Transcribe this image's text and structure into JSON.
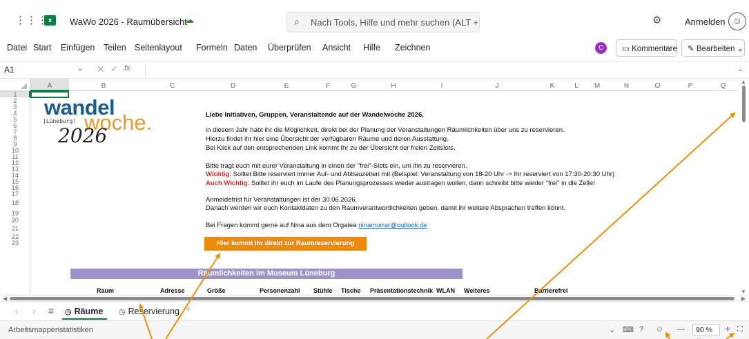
{
  "app": {
    "doc_title": "WaWo 2026 - Raumübersicht",
    "search_placeholder": "Nach Tools, Hilfe und mehr suchen (ALT + M",
    "signin_label": "Anmelden",
    "copilot_initial": "C"
  },
  "menu": {
    "items": [
      "Datei",
      "Start",
      "Einfügen",
      "Teilen",
      "Seitenlayout",
      "Formeln",
      "Daten",
      "Überprüfen",
      "Ansicht",
      "Hilfe",
      "Zeichnen"
    ],
    "comments_label": "Kommentare",
    "edit_label": "Bearbeiten"
  },
  "formula_bar": {
    "cell_ref": "A1",
    "fx": "fx",
    "value": ""
  },
  "grid": {
    "columns": [
      "A",
      "B",
      "C",
      "D",
      "E",
      "F",
      "G",
      "H",
      "I",
      "J",
      "K",
      "L",
      "M",
      "N",
      "O",
      "P",
      "Q"
    ],
    "rows": [
      "1",
      "2",
      "3",
      "4",
      "5",
      "6",
      "7",
      "8",
      "9",
      "10",
      "11",
      "12",
      "13",
      "14",
      "15",
      "16",
      "17",
      "18",
      "19",
      "20",
      "21",
      "22",
      "23"
    ],
    "selected_cell": "A1"
  },
  "logo": {
    "wandel": "wandel",
    "woche": "woche.",
    "lueneburg": "|Lüneburg!",
    "year": "2026"
  },
  "sheet": {
    "greeting": "Liebe Initiativen, Gruppen, Veranstaltende auf der Wandelwoche 2026,",
    "intro1": "in diesem Jahr habt ihr die Möglichkeit, direkt bei der Planung der Veranstaltungen Räumlichkeiten über uns zu reservieren.",
    "intro2": "Hierzu findet ihr hier eine Übersicht der verfügbaren Räume und deren Ausstattung.",
    "intro3": "Bei Klick auf den entsprechenden Link kommt Ihr zu der Übersicht der freien Zeitslots.",
    "instruction": "Bitte tragt euch mit eurer Veranstaltung in einen der \"frei\"-Slots ein, um ihn zu reservieren.",
    "important_label": "Wichtig",
    "important_text": ": Solltet Bitte reserviert immer Auf- und Abbauzeiten mit (Beispiel: Veranstaltung von 18-20 Uhr -> Ihr reserviert von 17:30-20:30 Uhr)",
    "also_important_label": "Auch Wichtig",
    "also_important_text": ": Solltet ihr euch im Laufe des Planungsprozesses wieder austragen wollen, dann schreibt bitte wieder \"frei\" in die Zelle!",
    "deadline": "Anmeldefrist für Veranstaltungen ist der 30.06.2026.",
    "contact_info": "Danach werden wir euch Kontaktdaten zu den Raumverantwortlichkeiten geben, damit ihr weitere Absprachen treffen könnt.",
    "questions_prefix": "Bei Fragen kommt gerne auf Nina aus dem Orgatea ",
    "email": "ninamurrar@outlook.de",
    "reserve_button": "Hier kommt ihr direkt zur Raumreservierung",
    "venue_heading": "Räumlichkeiten im Museum Lüneburg",
    "table_headers": [
      "Raum",
      "Adresse",
      "Größe",
      "Personenzahl",
      "Stühle",
      "Tische",
      "Präsentationstechnik",
      "WLAN",
      "Weiteres",
      "Barrierefrei"
    ]
  },
  "tabs": [
    {
      "label": "Räume",
      "active": true
    },
    {
      "label": "Reservierung",
      "active": false
    }
  ],
  "status": {
    "stats_label": "Arbeitsmappenstatistiken",
    "zoom": "90 %"
  },
  "colors": {
    "accent": "#107c41",
    "annotation": "#e8900c",
    "reserve_button": "#ec8a0b",
    "venue_band": "#9d93c8"
  }
}
